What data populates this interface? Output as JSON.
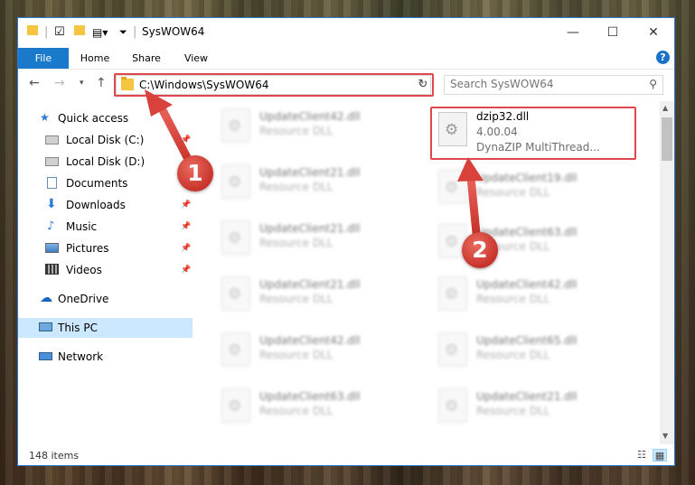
{
  "window": {
    "title": "SysWOW64",
    "controls": {
      "minimize": "—",
      "maximize": "☐",
      "close": "✕"
    }
  },
  "ribbon": {
    "tabs": [
      "File",
      "Home",
      "Share",
      "View"
    ],
    "help": "?"
  },
  "address": {
    "path": "C:\\Windows\\SysWOW64"
  },
  "search": {
    "placeholder": "Search SysWOW64"
  },
  "nav": {
    "items": [
      {
        "label": "Quick access",
        "icon": "star-icon"
      },
      {
        "label": "Local Disk (C:)",
        "icon": "drive-icon"
      },
      {
        "label": "Local Disk (D:)",
        "icon": "drive-icon"
      },
      {
        "label": "Documents",
        "icon": "documents-icon"
      },
      {
        "label": "Downloads",
        "icon": "download-icon"
      },
      {
        "label": "Music",
        "icon": "music-icon"
      },
      {
        "label": "Pictures",
        "icon": "pictures-icon"
      },
      {
        "label": "Videos",
        "icon": "videos-icon"
      },
      {
        "label": "OneDrive",
        "icon": "cloud-icon"
      },
      {
        "label": "This PC",
        "icon": "computer-icon"
      },
      {
        "label": "Network",
        "icon": "network-icon"
      }
    ]
  },
  "files": {
    "highlighted": {
      "name": "dzip32.dll",
      "version": "4.00.04",
      "description": "DynaZIP MultiThread..."
    },
    "left_column": [
      {
        "name": "UpdateClient42.dll",
        "type": "Resource DLL"
      },
      {
        "name": "UpdateClient21.dll",
        "type": "Resource DLL"
      },
      {
        "name": "UpdateClient21.dll",
        "type": "Resource DLL"
      },
      {
        "name": "UpdateClient21.dll",
        "type": "Resource DLL"
      },
      {
        "name": "UpdateClient42.dll",
        "type": "Resource DLL"
      },
      {
        "name": "UpdateClient63.dll",
        "type": "Resource DLL"
      }
    ],
    "right_column": [
      {
        "name": "UpdateClient19.dll",
        "type": "Resource DLL"
      },
      {
        "name": "UpdateClient63.dll",
        "type": "Resource DLL"
      },
      {
        "name": "UpdateClient42.dll",
        "type": "Resource DLL"
      },
      {
        "name": "UpdateClient65.dll",
        "type": "Resource DLL"
      },
      {
        "name": "UpdateClient21.dll",
        "type": "Resource DLL"
      }
    ]
  },
  "status": {
    "count": "148 items"
  },
  "annotations": {
    "badge1": "1",
    "badge2": "2",
    "color": "#d9413b"
  }
}
